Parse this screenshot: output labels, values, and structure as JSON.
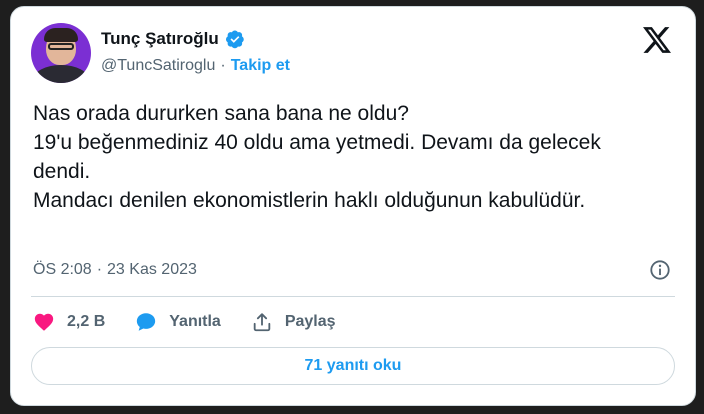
{
  "author": {
    "name": "Tunç Şatıroğlu",
    "handle": "@TuncSatiroglu",
    "separator": "·",
    "follow_label": "Takip et"
  },
  "tweet": {
    "lines": [
      "Nas orada dururken sana bana ne oldu?",
      "19'u beğenmediniz 40 oldu ama yetmedi. Devamı da gelecek dendi.",
      "Mandacı denilen ekonomistlerin haklı olduğunun kabulüdür."
    ],
    "time": "ÖS 2:08",
    "separator": "·",
    "date": "23 Kas 2023"
  },
  "actions": {
    "like_count": "2,2 B",
    "reply_label": "Yanıtla",
    "share_label": "Paylaş"
  },
  "replies_button": "71 yanıtı oku",
  "colors": {
    "accent": "#1d9bf0",
    "like": "#f91880",
    "text": "#0f1419",
    "secondary": "#536471"
  },
  "icons": {
    "verified": "verified-badge-icon",
    "logo": "x-logo-icon",
    "info": "info-icon",
    "like": "heart-icon",
    "reply": "speech-bubble-icon",
    "share": "share-upload-icon"
  }
}
